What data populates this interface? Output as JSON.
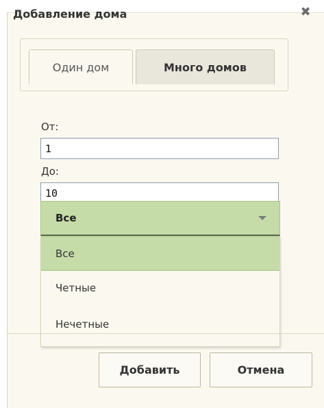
{
  "dialog": {
    "title": "Добавление дома",
    "close_icon": "close-icon"
  },
  "tabs": [
    {
      "label": "Один дом",
      "active": false
    },
    {
      "label": "Много домов",
      "active": true
    }
  ],
  "form": {
    "from_label": "От:",
    "from_value": "1",
    "to_label": "До:",
    "to_value": "10",
    "parity_select": {
      "selected": "Все",
      "options": [
        "Все",
        "Четные",
        "Нечетные"
      ]
    }
  },
  "buttons": {
    "add_label": "Добавить",
    "cancel_label": "Отмена"
  },
  "colors": {
    "selected_option_bg": "#c6dca8",
    "dialog_bg": "#fbf9ef"
  }
}
